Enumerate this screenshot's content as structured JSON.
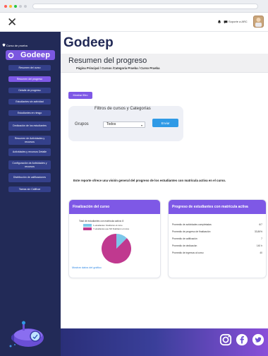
{
  "top_bar": {
    "support_label": "Soporte a ARC"
  },
  "sidebar": {
    "course_link": "Curso de prueba",
    "logo": "Godeep",
    "items": [
      {
        "label": "Resumen del curso",
        "active": false
      },
      {
        "label": "Resumen del progreso",
        "active": true
      },
      {
        "label": "Detalle de progreso",
        "active": false
      },
      {
        "label": "Estudiantes sin actividad",
        "active": false
      },
      {
        "label": "Estudiantes en riesgo",
        "active": false
      },
      {
        "label": "Dedicación de los estudiantes",
        "active": false
      },
      {
        "label": "Resumen de Actividades y recursos",
        "active": false
      },
      {
        "label": "Actividades y recursos Detalle",
        "active": false
      },
      {
        "label": "Configuración de Actividades y recursos",
        "active": false
      },
      {
        "label": "Distribución de calificaciones",
        "active": false
      },
      {
        "label": "Tareas sin Calificar",
        "active": false
      }
    ]
  },
  "main": {
    "brand": "Godeep",
    "title": "Resumen del progreso",
    "breadcrumb": "Página Principal / Cursos /Categoría Prueba / Curso Prueba",
    "filter_button": "Mostrar filtro",
    "filter": {
      "title": "Filtros de cursos y Categorías",
      "group_label": "Grupos",
      "group_value": "Todos",
      "submit_label": "Enviar"
    },
    "intro": "Este reporte ofrece una visión general del progreso de los estudiantes con matrícula activa en el curso.",
    "completion_card": {
      "title": "Finalización del curso",
      "pie_title": "Total de estudiantes con matrícula activa: 8",
      "legend": [
        {
          "label": "1 estudiantes: finalizaron el curso",
          "color": "#7cc7ea"
        },
        {
          "label": "7 estudiantes que NO finalizaron el curso",
          "color": "#c0398f"
        }
      ],
      "show_data": "Mostrar datos del gráfico"
    },
    "progress_card": {
      "title": "Progreso de estudiantes con matrícula activa",
      "stats": [
        {
          "label": "Promedio de actividades completadas",
          "value": "6/7"
        },
        {
          "label": "Promedio de progreso de finalización",
          "value": "33,86%"
        },
        {
          "label": "Promedio de calificación",
          "value": "7"
        },
        {
          "label": "Promedio de dedicación",
          "value": "140 h"
        },
        {
          "label": "Promedio de ingresos al curso",
          "value": "40"
        }
      ]
    }
  },
  "chart_data": {
    "type": "pie",
    "title": "Total de estudiantes con matrícula activa: 8",
    "series": [
      {
        "name": "1 estudiantes: finalizaron el curso",
        "values": [
          1
        ]
      },
      {
        "name": "7 estudiantes que NO finalizaron el curso",
        "values": [
          7
        ]
      }
    ],
    "colors": [
      "#7cc7ea",
      "#c0398f"
    ]
  }
}
